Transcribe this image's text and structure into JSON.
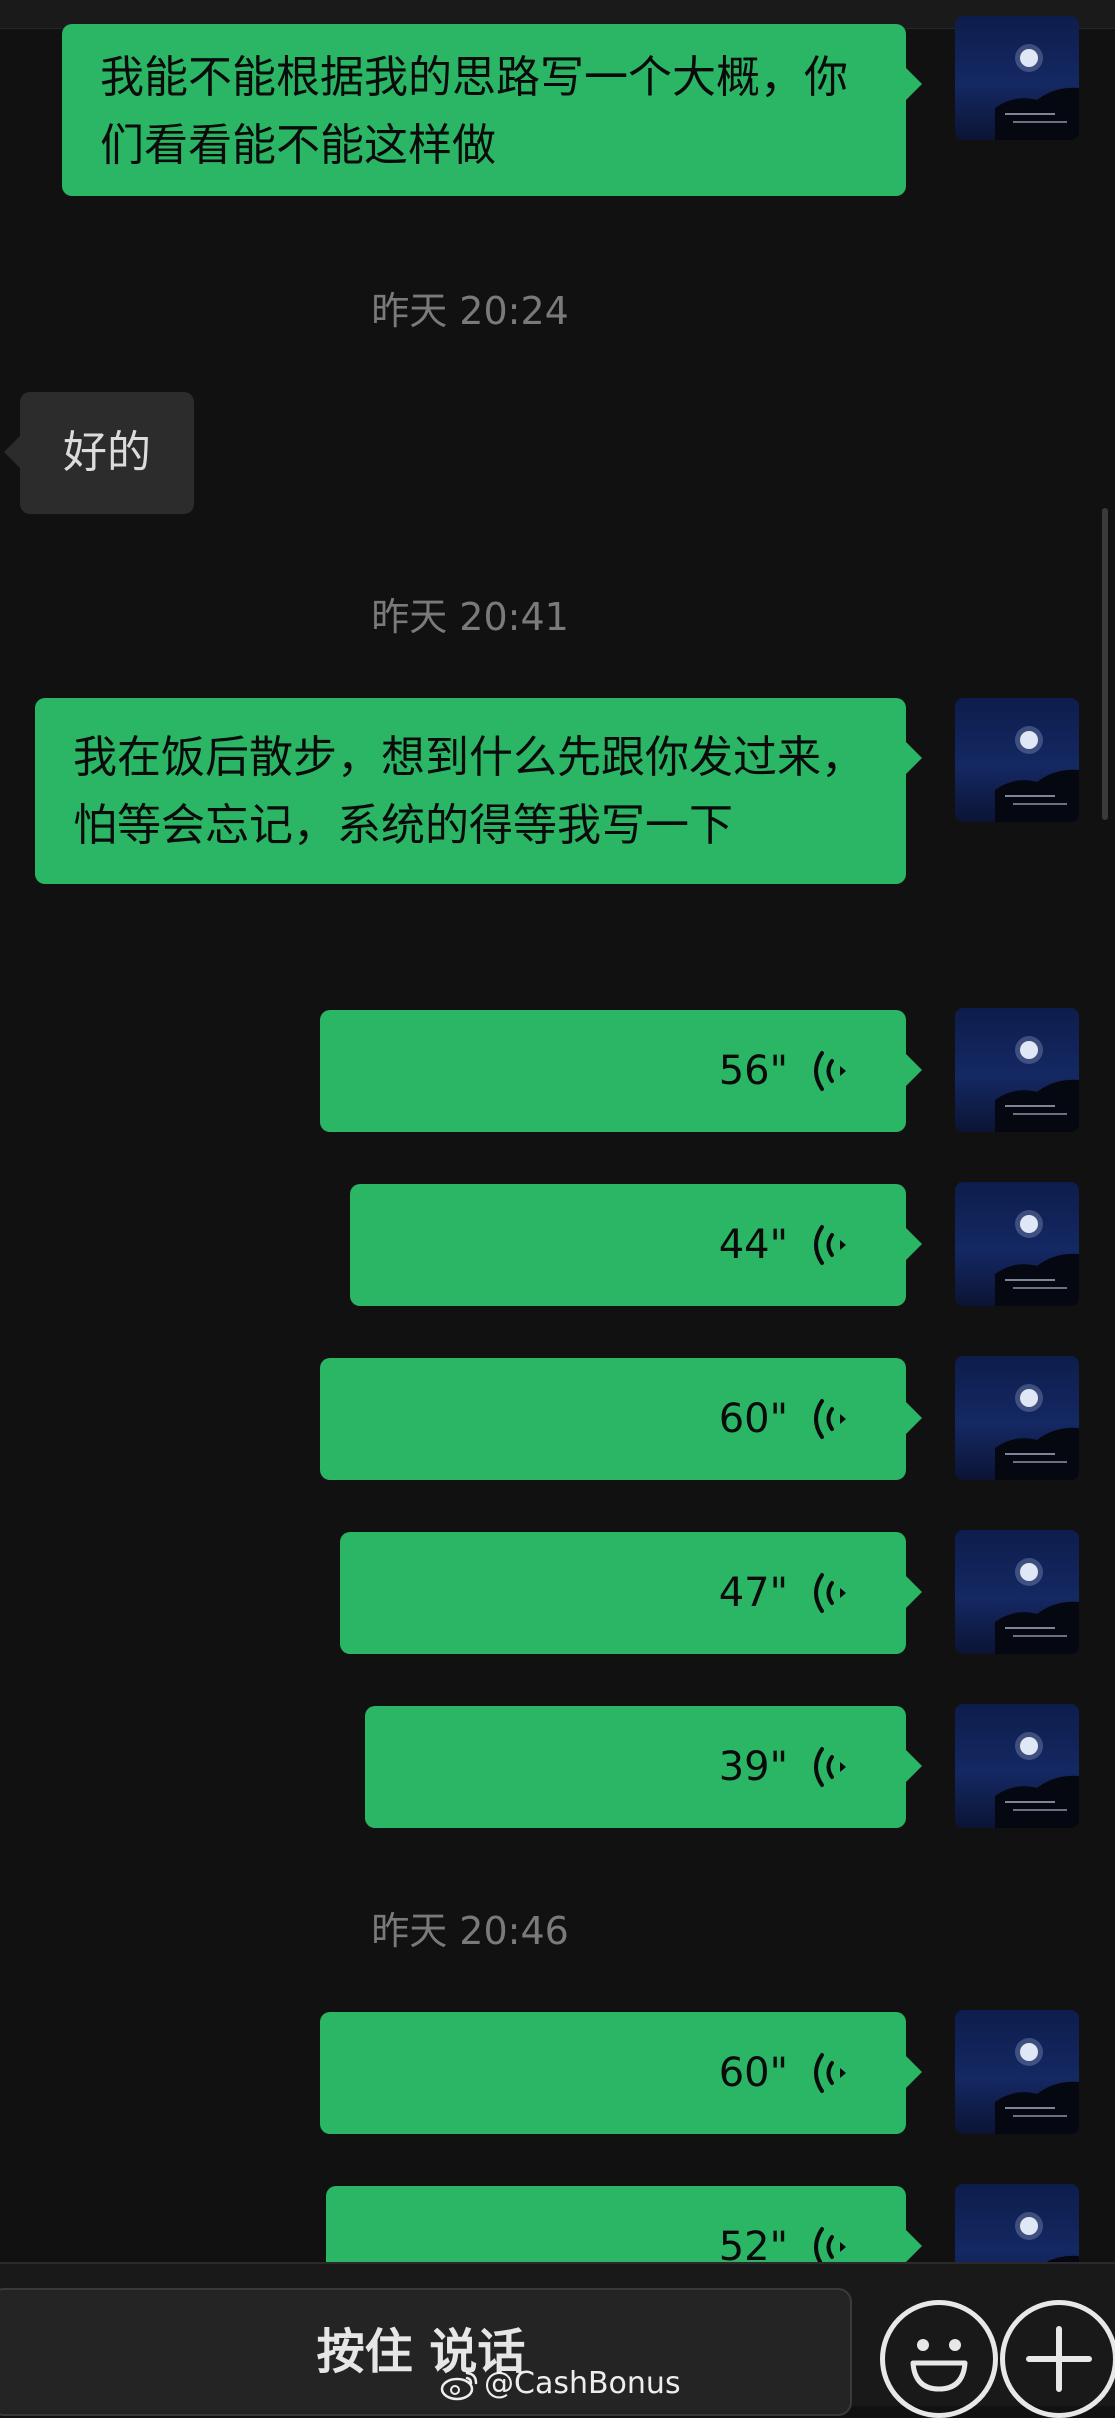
{
  "messages": {
    "m1": {
      "text": "我能不能根据我的思路写一个大概，你们看看能不能这样做"
    },
    "t1": "昨天 20:24",
    "m2": {
      "text": "好的"
    },
    "t2": "昨天 20:41",
    "m3": {
      "text": "我在饭后散步，想到什么先跟你发过来，怕等会忘记，系统的得等我写一下"
    },
    "voices": [
      {
        "duration": "56\""
      },
      {
        "duration": "44\""
      },
      {
        "duration": "60\""
      },
      {
        "duration": "47\""
      },
      {
        "duration": "39\""
      },
      {
        "duration": "60\""
      },
      {
        "duration": "52\""
      }
    ],
    "t3": "昨天 20:46"
  },
  "input_bar": {
    "hold_to_talk_label": "按住 说话",
    "emoji_icon": "smiley-icon",
    "more_icon": "plus-icon"
  },
  "watermark": {
    "text": "@CashBonus",
    "icon": "weibo-logo"
  },
  "colors": {
    "background": "#111111",
    "outgoing_bubble": "#2ab664",
    "incoming_bubble": "#2c2c2c",
    "timestamp": "#7a7a7a"
  }
}
